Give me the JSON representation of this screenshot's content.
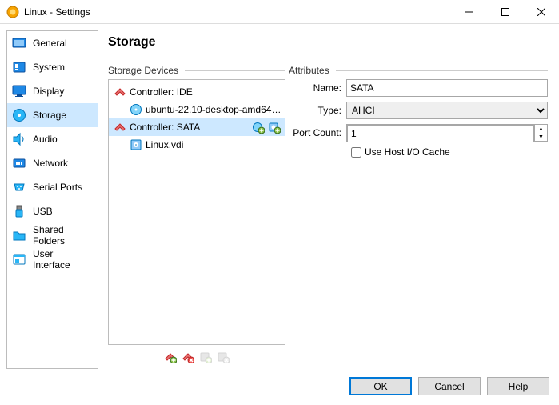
{
  "window": {
    "title": "Linux - Settings"
  },
  "sidebar": {
    "items": [
      {
        "label": "General"
      },
      {
        "label": "System"
      },
      {
        "label": "Display"
      },
      {
        "label": "Storage"
      },
      {
        "label": "Audio"
      },
      {
        "label": "Network"
      },
      {
        "label": "Serial Ports"
      },
      {
        "label": "USB"
      },
      {
        "label": "Shared Folders"
      },
      {
        "label": "User Interface"
      }
    ]
  },
  "page": {
    "title": "Storage"
  },
  "storage": {
    "group_label": "Storage Devices",
    "controllers": [
      {
        "label": "Controller: IDE",
        "children": [
          {
            "label": "ubuntu-22.10-desktop-amd64.i..."
          }
        ]
      },
      {
        "label": "Controller: SATA",
        "children": [
          {
            "label": "Linux.vdi"
          }
        ]
      }
    ]
  },
  "attributes": {
    "group_label": "Attributes",
    "name_label": "Name:",
    "name_value": "SATA",
    "type_label": "Type:",
    "type_value": "AHCI",
    "port_label": "Port Count:",
    "port_value": "1",
    "cache_label": "Use Host I/O Cache"
  },
  "footer": {
    "ok": "OK",
    "cancel": "Cancel",
    "help": "Help"
  }
}
